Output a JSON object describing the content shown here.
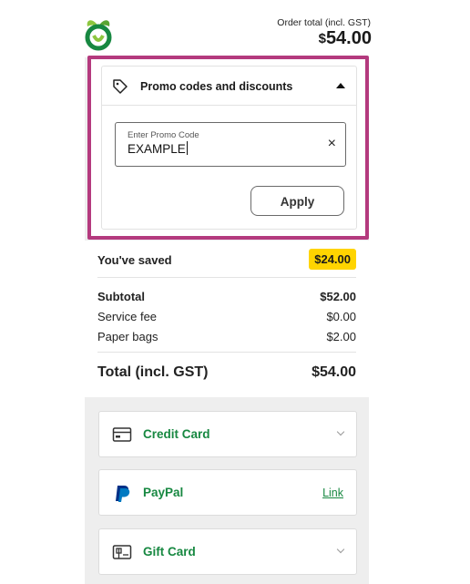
{
  "header": {
    "order_total_label": "Order total (incl. GST)",
    "order_total_currency": "$",
    "order_total_amount": "54.00",
    "logo_icon": "woolworths-logo-icon"
  },
  "promo": {
    "title": "Promo codes and discounts",
    "tag_icon": "tag-icon",
    "expanded": true,
    "input_placeholder": "Enter Promo Code",
    "input_value": "EXAMPLE",
    "clear_icon": "×",
    "apply_label": "Apply"
  },
  "summary": {
    "saved_label": "You've saved",
    "saved_value": "$24.00",
    "subtotal_label": "Subtotal",
    "subtotal_value": "$52.00",
    "service_label": "Service fee",
    "service_value": "$0.00",
    "bags_label": "Paper bags",
    "bags_value": "$2.00",
    "total_label": "Total (incl. GST)",
    "total_value": "$54.00"
  },
  "payment_methods": [
    {
      "label": "Credit Card",
      "icon": "credit-card-icon",
      "action": "chevron"
    },
    {
      "label": "PayPal",
      "icon": "paypal-icon",
      "action": "Link"
    },
    {
      "label": "Gift Card",
      "icon": "gift-card-icon",
      "action": "chevron"
    }
  ],
  "colors": {
    "highlight_border": "#b43a7e",
    "brand_green": "#178841",
    "saved_badge": "#ffd400"
  }
}
